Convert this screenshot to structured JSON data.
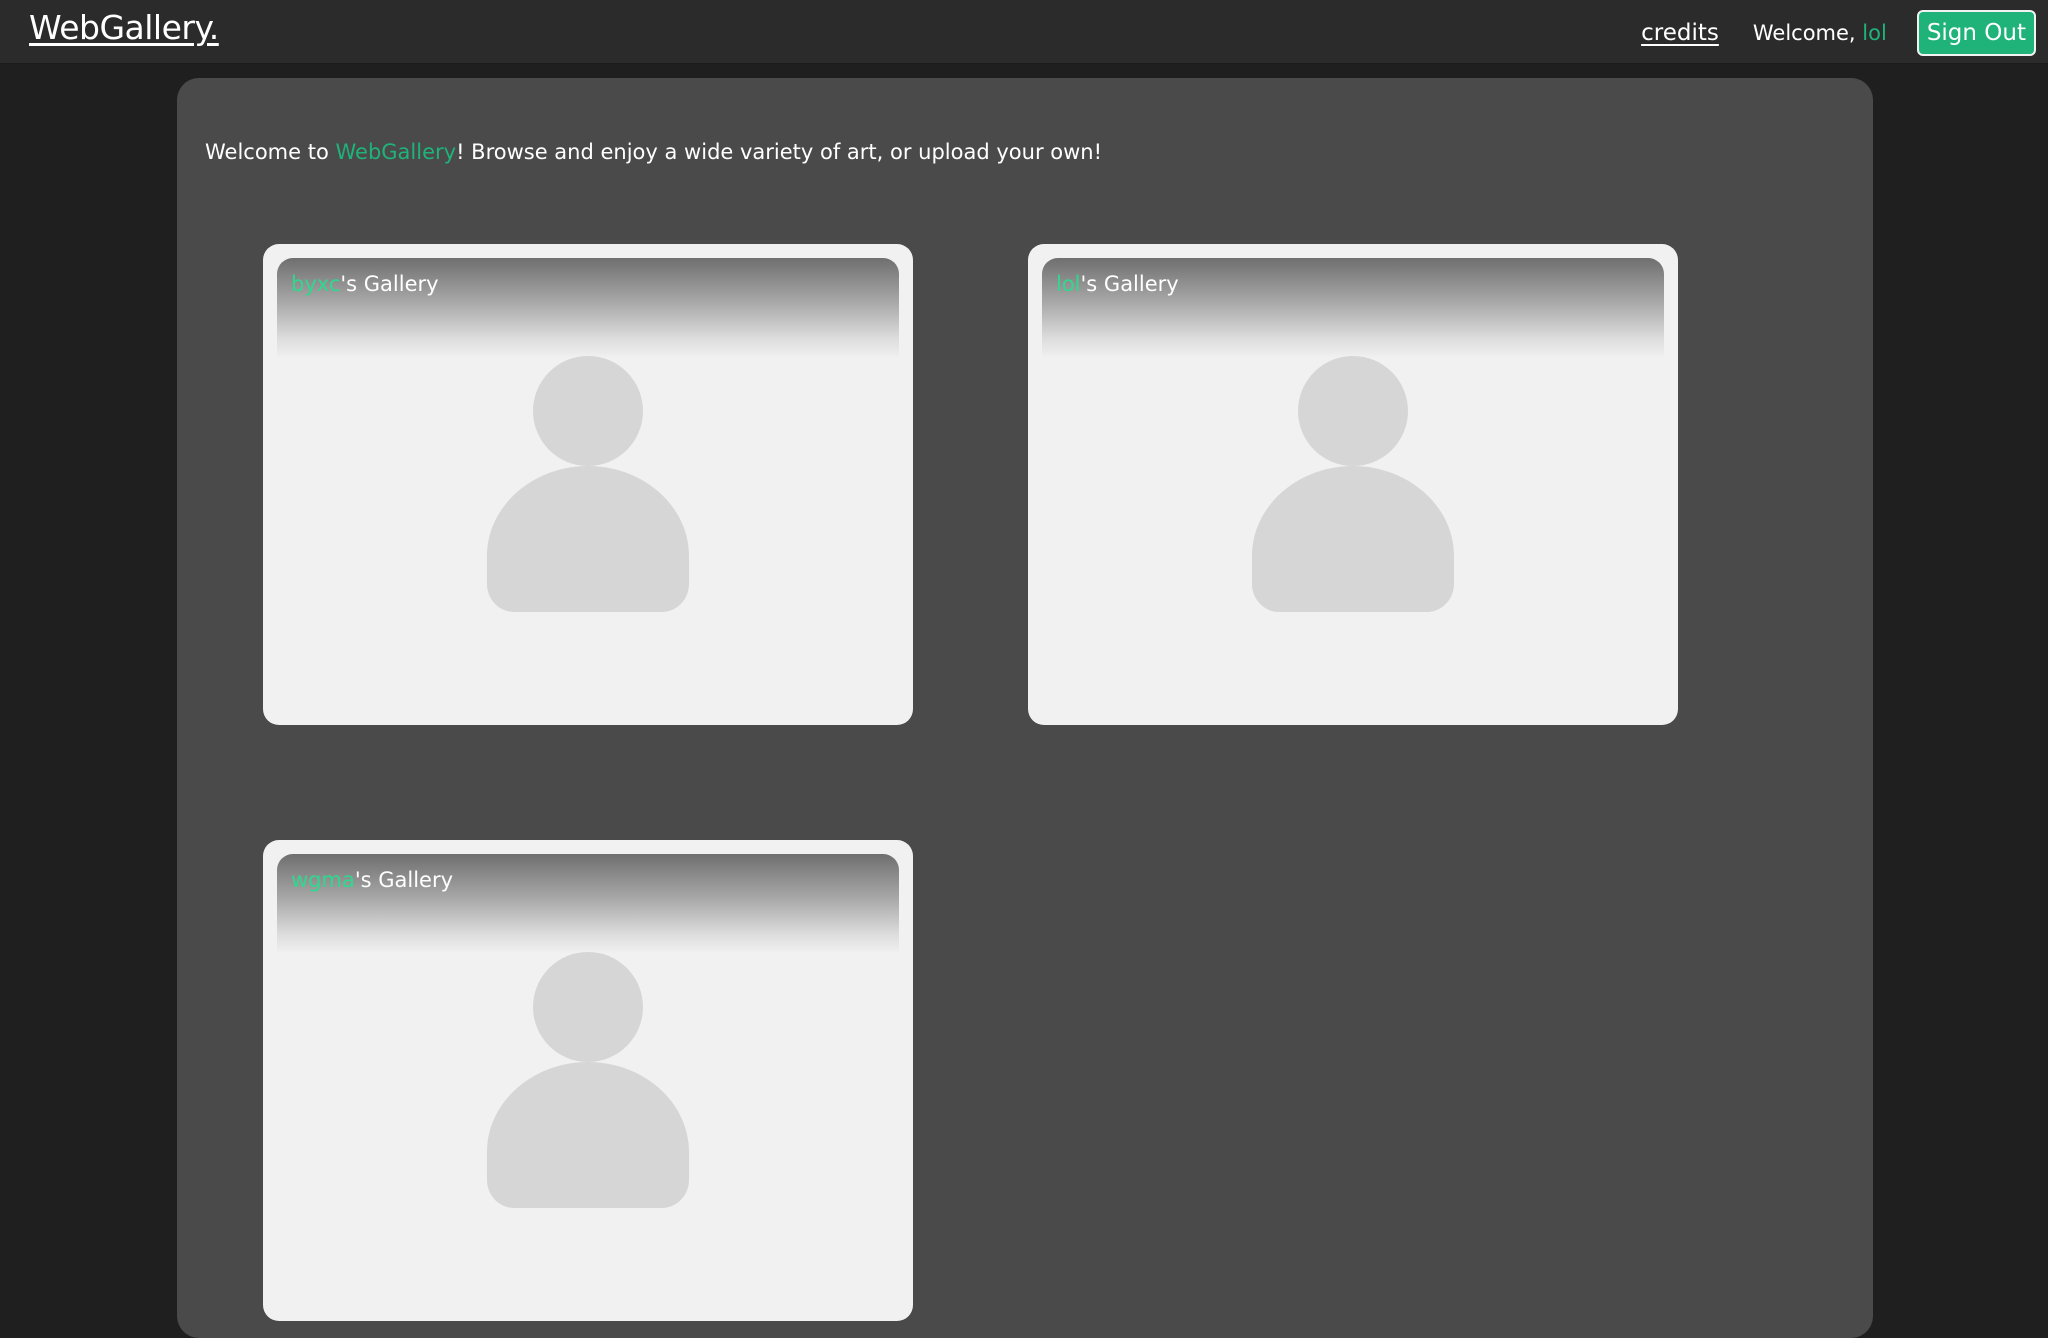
{
  "navbar": {
    "brand": "WebGallery.",
    "credits_label": "credits",
    "welcome_prefix": "Welcome, ",
    "username": "lol",
    "signout_label": "Sign Out"
  },
  "intro": {
    "prefix": "Welcome to ",
    "site_name": "WebGallery",
    "suffix": "! Browse and enjoy a wide variety of art, or upload your own!"
  },
  "galleries": [
    {
      "owner": "byxc",
      "title_suffix": "'s Gallery",
      "icon": "avatar-placeholder-icon"
    },
    {
      "owner": "lol",
      "title_suffix": "'s Gallery",
      "icon": "avatar-placeholder-icon"
    },
    {
      "owner": "wgma",
      "title_suffix": "'s Gallery",
      "icon": "avatar-placeholder-icon"
    }
  ],
  "colors": {
    "accent": "#1fb37a",
    "owner_name": "#2ed88f",
    "page_background": "#1f1f1f",
    "navbar_background": "#2b2b2b",
    "panel_background": "#4a4a4a",
    "card_background": "#f1f1f1",
    "avatar_fill": "#d6d6d6"
  }
}
